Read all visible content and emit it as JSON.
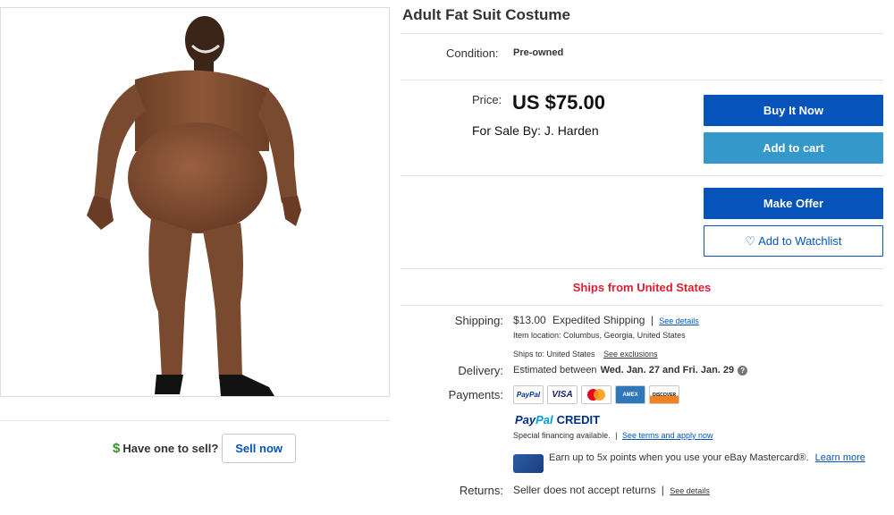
{
  "item": {
    "title": "Adult Fat Suit Costume",
    "condition_label": "Condition:",
    "condition_value": "Pre-owned"
  },
  "price": {
    "label": "Price:",
    "value": "US $75.00",
    "seller": "For Sale By: J. Harden"
  },
  "actions": {
    "buy_now": "Buy It Now",
    "add_to_cart": "Add to cart",
    "make_offer": "Make Offer",
    "watchlist_icon": "♡",
    "watchlist": "Add to Watchlist"
  },
  "ships_from": "Ships from United States",
  "shipping": {
    "label": "Shipping:",
    "cost": "$13.00",
    "method": "Expedited Shipping",
    "details_link": "See details",
    "location": "Item location:  Columbus, Georgia, United States",
    "ships_to": "Ships to:  United States",
    "exclusions_link": "See exclusions"
  },
  "delivery": {
    "label": "Delivery:",
    "prefix": "Estimated between",
    "dates": "Wed. Jan. 27 and Fri. Jan. 29",
    "info_icon": "?"
  },
  "payments": {
    "label": "Payments:",
    "logos": [
      "PayPal",
      "VISA",
      "Mastercard",
      "AMEX",
      "DISCOVER"
    ],
    "paypal_word1": "Pay",
    "paypal_word2": "Pal",
    "paypal_credit": "CREDIT",
    "financing": "Special financing available.",
    "financing_link": "See terms and apply now",
    "earn_text": "Earn up to 5x points when you use your eBay Mastercard®.",
    "learn_more": "Learn more"
  },
  "returns": {
    "label": "Returns:",
    "text": "Seller does not accept returns",
    "details_link": "See details"
  },
  "sell": {
    "dollar_icon": "$",
    "question": "Have one to sell?",
    "button": "Sell now"
  },
  "colors": {
    "primary_blue": "#0654ba",
    "light_blue": "#3498ca",
    "ships_red": "#dd1e31",
    "suit_brown": "#7a4a30"
  }
}
